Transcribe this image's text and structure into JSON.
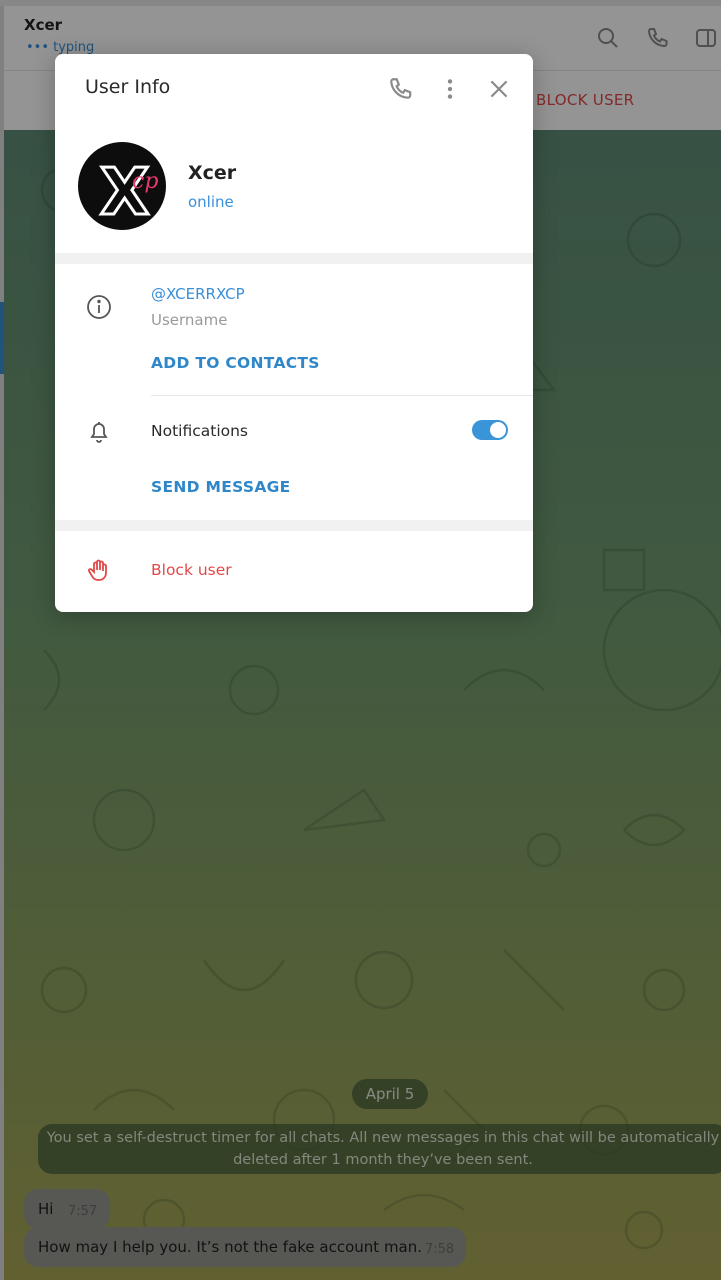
{
  "chat_header": {
    "contact_name": "Xcer",
    "status": "••• typing",
    "block_user_label": "BLOCK USER"
  },
  "dialog": {
    "title": "User Info",
    "profile": {
      "name": "Xcer",
      "status": "online",
      "avatar_text": "X",
      "avatar_subtext": "cp"
    },
    "username": "@XCERRXCP",
    "username_label": "Username",
    "add_to_contacts": "ADD TO CONTACTS",
    "notifications_label": "Notifications",
    "notifications_enabled": true,
    "send_message": "SEND MESSAGE",
    "block_user": "Block user"
  },
  "chat": {
    "date": "April 5",
    "service_line1": "You set a self-destruct timer for all chats. All new messages in this chat will be automatically",
    "service_line2": "deleted after 1 month they’ve been sent.",
    "messages": [
      {
        "text": "Hi",
        "time": "7:57"
      },
      {
        "text": "How may I help you. It’s not the  fake account man.",
        "time": "7:58"
      }
    ]
  },
  "colors": {
    "accent": "#3a8fd9",
    "danger": "#e0494a",
    "toggle_on": "#3a95d8"
  },
  "icons": [
    "search-icon",
    "phone-icon",
    "sidebar-icon",
    "more-vertical-icon",
    "close-icon",
    "info-icon",
    "bell-icon",
    "hand-icon"
  ]
}
